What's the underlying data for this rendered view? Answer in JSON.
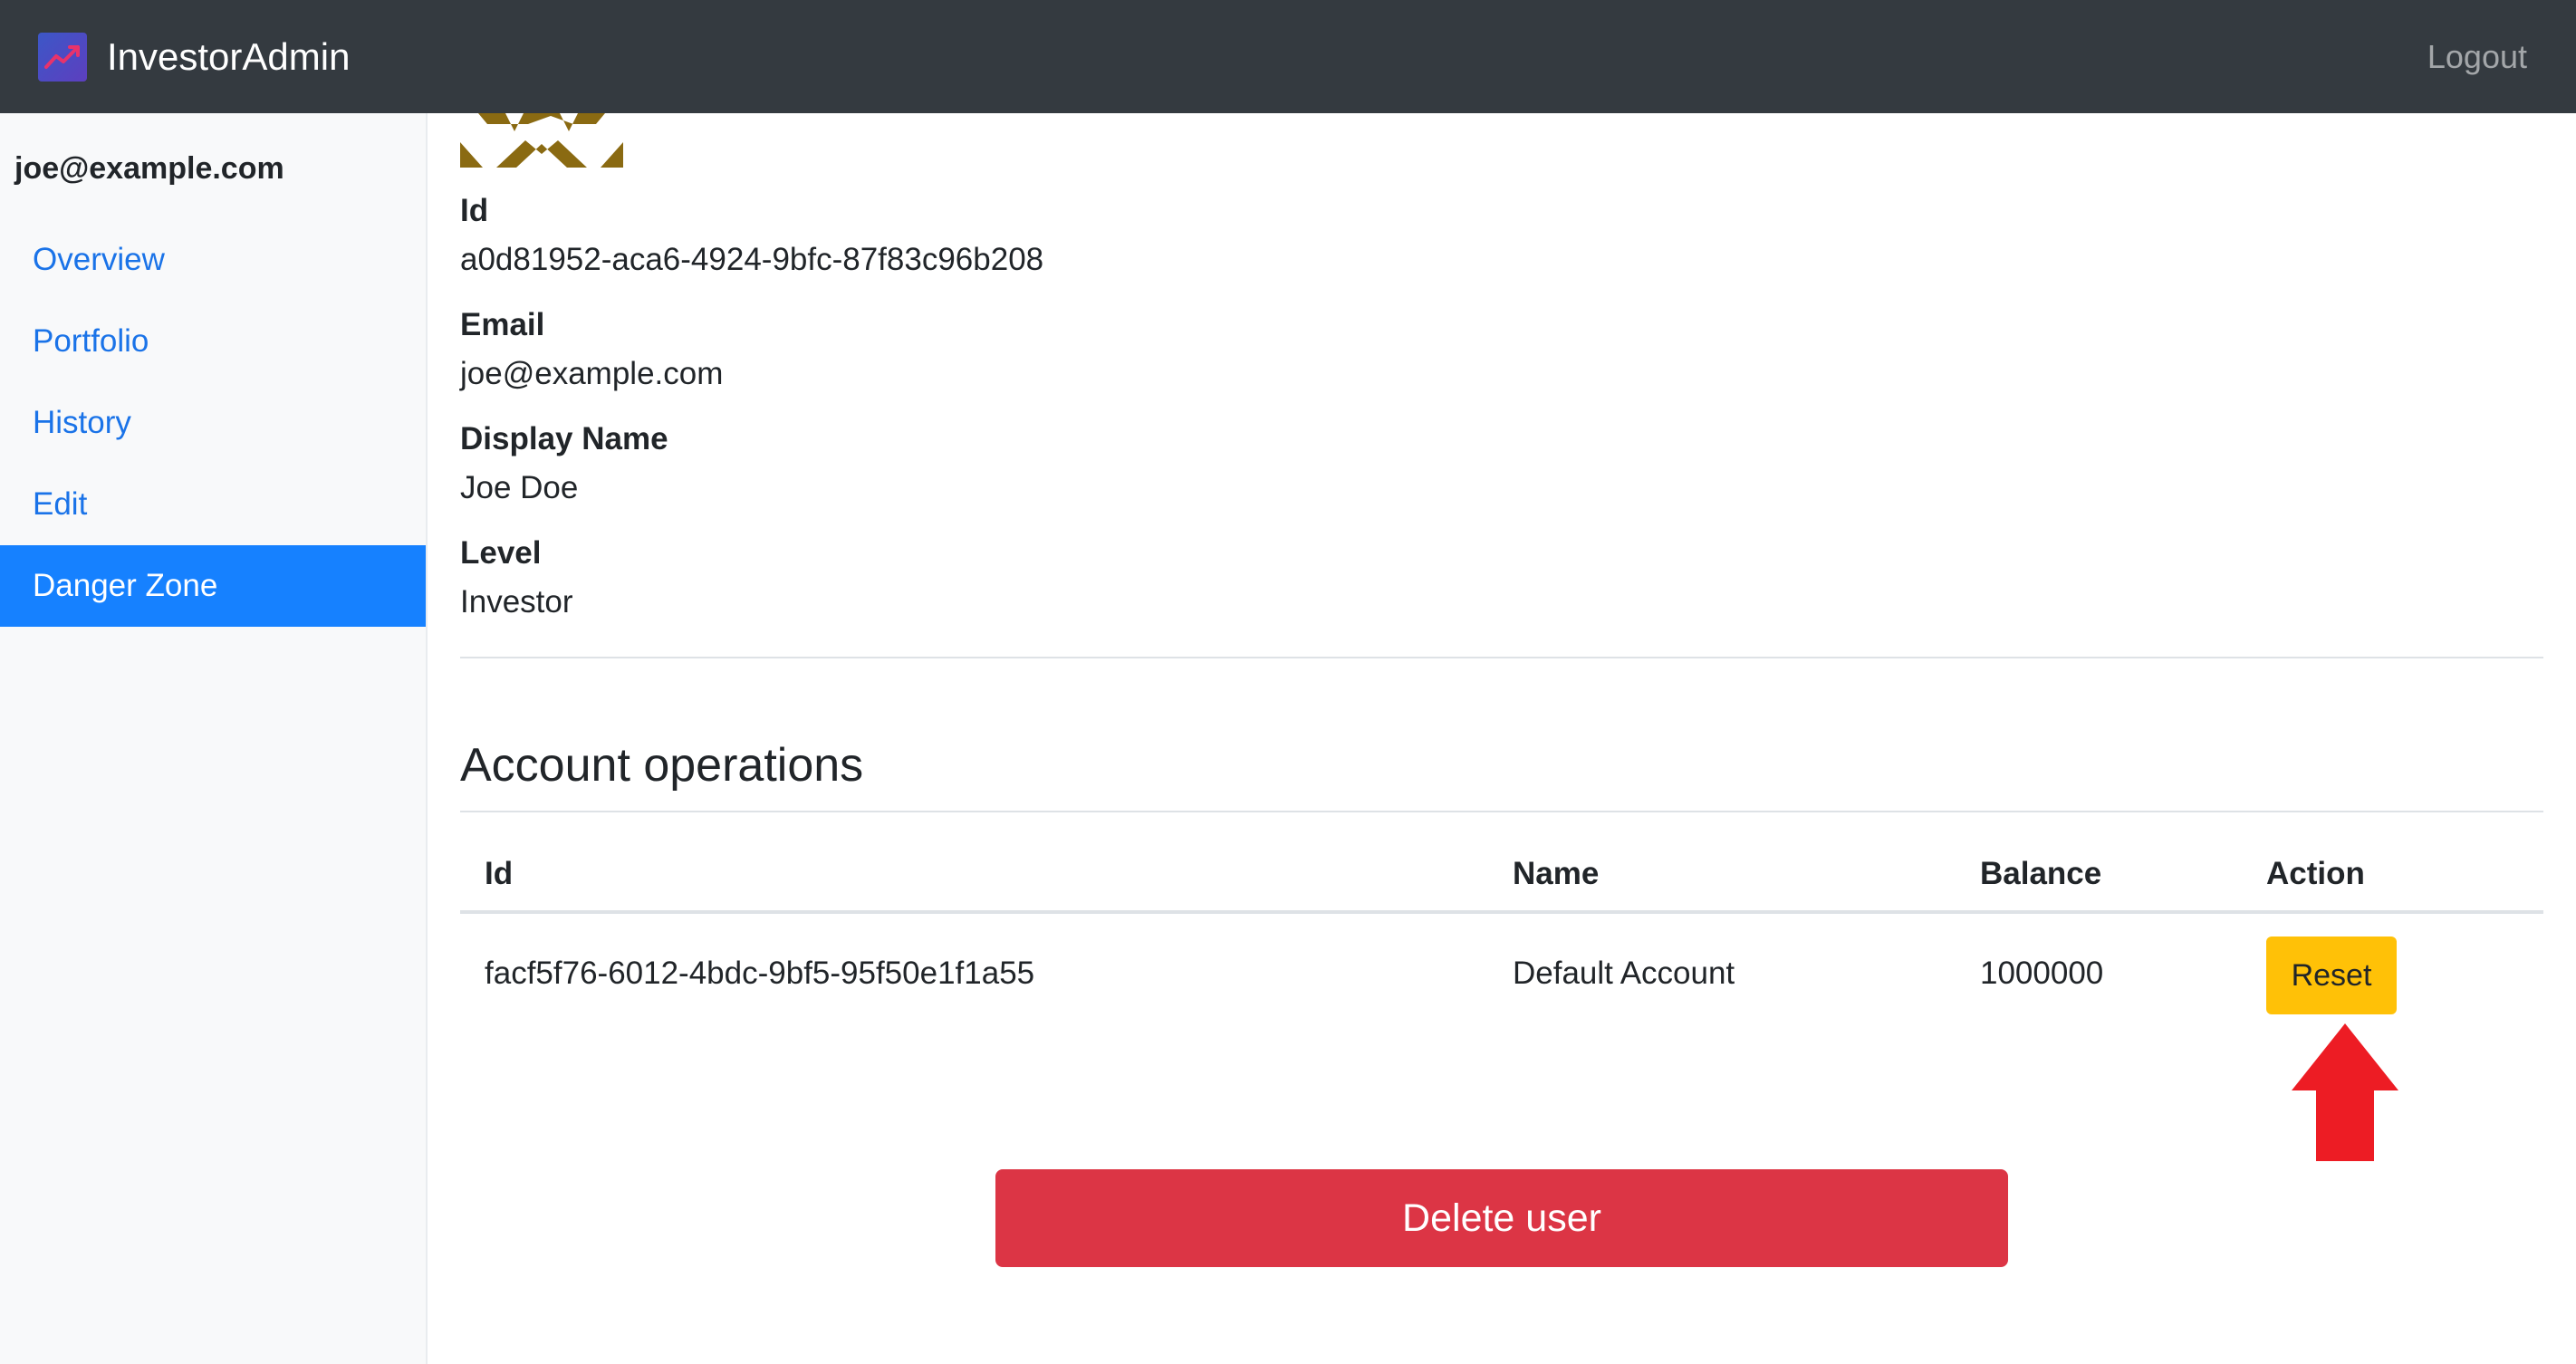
{
  "navbar": {
    "brand": "InvestorAdmin",
    "brand_icon": "trending-chart-icon",
    "logout": "Logout"
  },
  "sidebar": {
    "user_email": "joe@example.com",
    "items": [
      {
        "label": "Overview",
        "active": false
      },
      {
        "label": "Portfolio",
        "active": false
      },
      {
        "label": "History",
        "active": false
      },
      {
        "label": "Edit",
        "active": false
      },
      {
        "label": "Danger Zone",
        "active": true
      }
    ]
  },
  "profile": {
    "avatar_icon": "identicon-avatar",
    "fields": [
      {
        "label": "Id",
        "value": "a0d81952-aca6-4924-9bfc-87f83c96b208"
      },
      {
        "label": "Email",
        "value": "joe@example.com"
      },
      {
        "label": "Display Name",
        "value": "Joe Doe"
      },
      {
        "label": "Level",
        "value": "Investor"
      }
    ]
  },
  "account_operations": {
    "title": "Account operations",
    "columns": [
      "Id",
      "Name",
      "Balance",
      "Action"
    ],
    "rows": [
      {
        "id": "facf5f76-6012-4bdc-9bf5-95f50e1f1a55",
        "name": "Default Account",
        "balance": "1000000",
        "action": "Reset"
      }
    ]
  },
  "delete_button": "Delete user",
  "colors": {
    "navbar": "#343a40",
    "sidebar": "#f8f9fa",
    "active_item": "#1681ff",
    "link": "#1a73e8",
    "warning": "#ffc107",
    "danger": "#dc3545",
    "annotation_arrow": "#ed1c24"
  }
}
